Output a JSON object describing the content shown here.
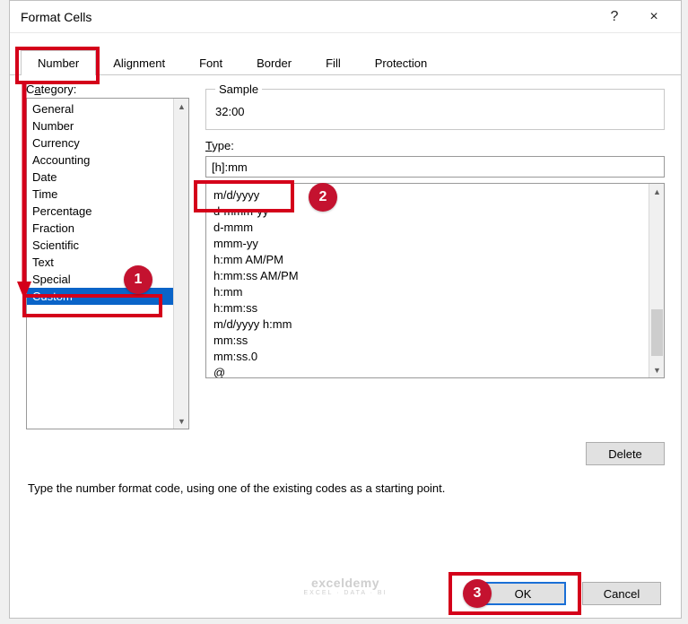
{
  "dialog": {
    "title": "Format Cells",
    "help_icon": "?",
    "close_icon": "×"
  },
  "tabs": {
    "number": "Number",
    "alignment": "Alignment",
    "font": "Font",
    "border": "Border",
    "fill": "Fill",
    "protection": "Protection"
  },
  "category": {
    "label_pre": "C",
    "label_u": "a",
    "label_post": "tegory:",
    "items": [
      "General",
      "Number",
      "Currency",
      "Accounting",
      "Date",
      "Time",
      "Percentage",
      "Fraction",
      "Scientific",
      "Text",
      "Special",
      "Custom"
    ],
    "selected": "Custom"
  },
  "sample": {
    "legend": "Sample",
    "value": "32:00"
  },
  "type": {
    "label_pre": "",
    "label_u": "T",
    "label_post": "ype:",
    "value": "[h]:mm",
    "formats": [
      "m/d/yyyy",
      "d-mmm-yy",
      "d-mmm",
      "mmm-yy",
      "h:mm AM/PM",
      "h:mm:ss AM/PM",
      "h:mm",
      "h:mm:ss",
      "m/d/yyyy h:mm",
      "mm:ss",
      "mm:ss.0",
      "@"
    ]
  },
  "buttons": {
    "delete_pre": "",
    "delete_u": "D",
    "delete_post": "elete",
    "ok": "OK",
    "cancel": "Cancel"
  },
  "hint": "Type the number format code, using one of the existing codes as a starting point.",
  "watermark": {
    "main": "exceldemy",
    "sub": "EXCEL · DATA · BI"
  },
  "annotations": {
    "badge1": "1",
    "badge2": "2",
    "badge3": "3"
  }
}
